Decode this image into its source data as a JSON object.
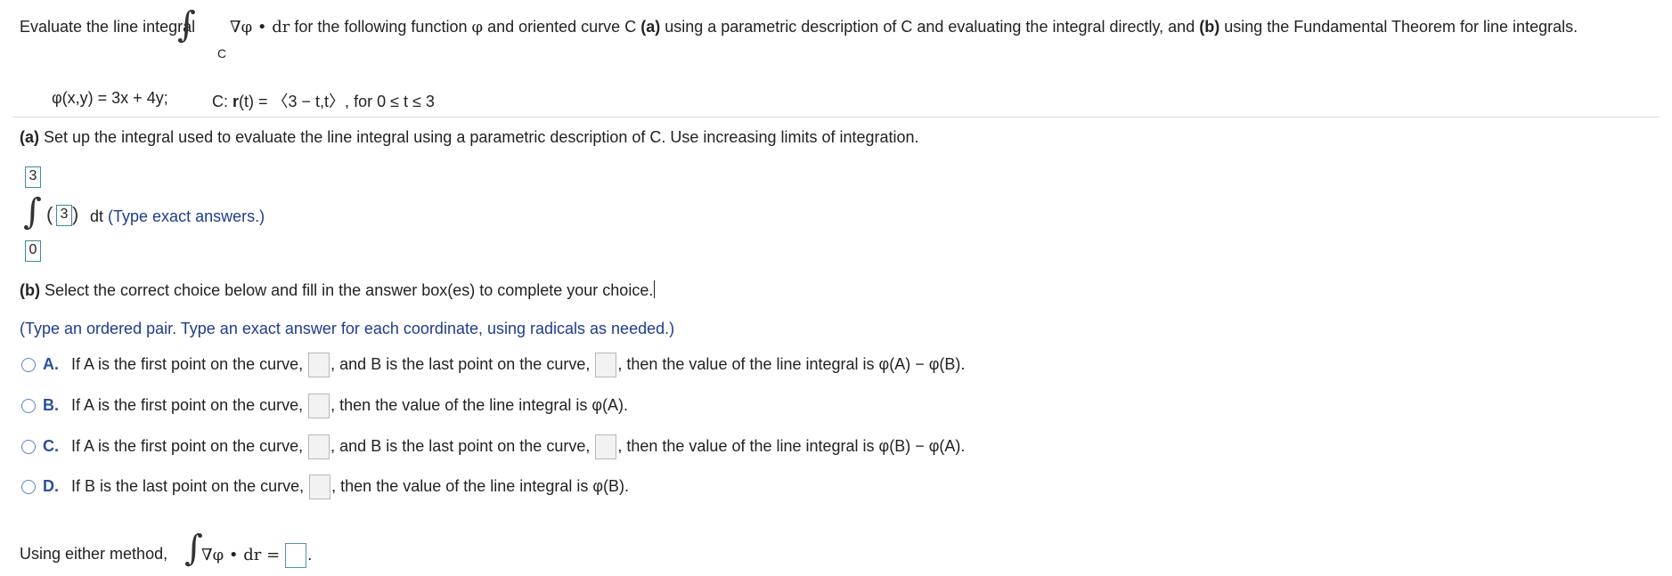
{
  "question": {
    "intro_before": "Evaluate the line integral",
    "integrand": "∇φ • dr",
    "sub_c": "C",
    "intro_after_1": " for the following function ",
    "phi": "φ",
    "intro_after_2": " and oriented curve C ",
    "part_a_tag": "(a)",
    "text_a": " using a parametric description of C and evaluating the integral directly, and ",
    "part_b_tag": "(b)",
    "text_b": " using the Fundamental Theorem for line integrals."
  },
  "given": {
    "function": "φ(x,y) = 3x + 4y;",
    "curve_prefix": "C: ",
    "curve_r": "r",
    "curve_rest": "(t) = 〈3 − t,t〉, for 0 ≤ t ≤ 3"
  },
  "part_a": {
    "tag": "(a)",
    "instruction": " Set up the integral used to evaluate the line integral using a parametric description of C. Use increasing limits of integration.",
    "upper_limit": "3",
    "lower_limit": "0",
    "integrand_value": "3",
    "dt": "dt",
    "hint": "(Type exact answers.)"
  },
  "part_b": {
    "tag": "(b)",
    "instruction": " Select the correct choice below and fill in the answer box(es) to complete your choice.",
    "hint": "(Type an ordered pair. Type an exact answer for each coordinate, using radicals as needed.)",
    "choices": [
      {
        "letter": "A.",
        "t1": "If A is the first point on the curve,",
        "t2": ", and B is the last point on the curve,",
        "t3": ", then the value of the line integral is φ(A) − φ(B)."
      },
      {
        "letter": "B.",
        "t1": "If A is the first point on the curve,",
        "t3": ", then the value of the line integral is φ(A)."
      },
      {
        "letter": "C.",
        "t1": "If A is the first point on the curve,",
        "t2": ", and B is the last point on the curve,",
        "t3": ", then the value of the line integral is φ(B) − φ(A)."
      },
      {
        "letter": "D.",
        "t1": "If B is the last point on the curve,",
        "t3": ", then the value of the line integral is φ(B)."
      }
    ]
  },
  "final": {
    "label": "Using either method,",
    "integrand": "∇φ • dr =",
    "period": "."
  }
}
